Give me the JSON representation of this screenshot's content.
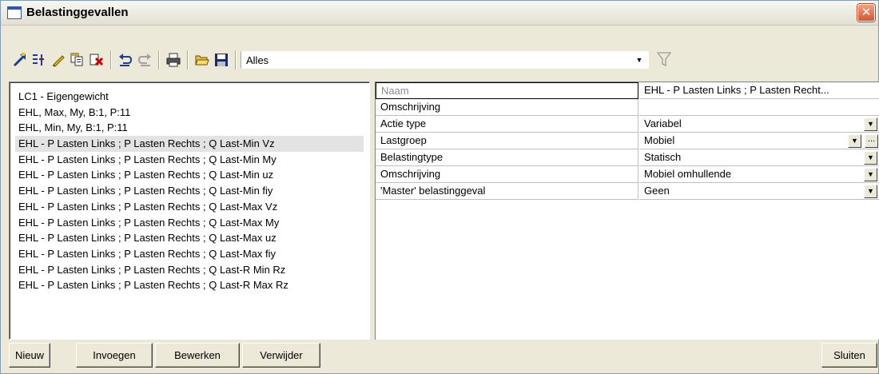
{
  "window": {
    "title": "Belastinggevallen",
    "close_label": "✕"
  },
  "toolbar": {
    "icons": [
      "new-load-case-icon",
      "insert-icon",
      "edit-icon",
      "copy-icon",
      "delete-icon",
      "undo-icon",
      "redo-icon",
      "print-icon",
      "open-folder-icon",
      "save-icon"
    ],
    "filter_value": "Alles",
    "filter_icon": "funnel-filter-icon"
  },
  "load_cases": [
    "LC1 - Eigengewicht",
    "EHL, Max, My, B:1, P:11",
    "EHL, Min, My, B:1, P:11",
    "EHL - P Lasten Links ; P Lasten Rechts ; Q Last-Min Vz",
    "EHL - P Lasten Links ; P Lasten Rechts ; Q Last-Min My",
    "EHL - P Lasten Links ; P Lasten Rechts ; Q Last-Min uz",
    "EHL - P Lasten Links ; P Lasten Rechts ; Q Last-Min fiy",
    "EHL - P Lasten Links ; P Lasten Rechts ; Q Last-Max Vz",
    "EHL - P Lasten Links ; P Lasten Rechts ; Q Last-Max My",
    "EHL - P Lasten Links ; P Lasten Rechts ; Q Last-Max uz",
    "EHL - P Lasten Links ; P Lasten Rechts ; Q Last-Max fiy",
    "EHL - P Lasten Links ; P Lasten Rechts ; Q Last-R Min Rz",
    "EHL - P Lasten Links ; P Lasten Rechts ; Q Last-R Max Rz"
  ],
  "selected_index": 3,
  "properties": [
    {
      "name": "Naam",
      "value": "EHL - P Lasten Links ; P Lasten Recht...",
      "dropdown": false,
      "ellipsis": false
    },
    {
      "name": "Omschrijving",
      "value": "",
      "dropdown": false,
      "ellipsis": false
    },
    {
      "name": "Actie type",
      "value": "Variabel",
      "dropdown": true,
      "ellipsis": false
    },
    {
      "name": "Lastgroep",
      "value": "Mobiel",
      "dropdown": true,
      "ellipsis": true
    },
    {
      "name": "Belastingtype",
      "value": "Statisch",
      "dropdown": true,
      "ellipsis": false
    },
    {
      "name": "Omschrijving",
      "value": "Mobiel omhullende",
      "dropdown": true,
      "ellipsis": false
    },
    {
      "name": "'Master' belastinggeval",
      "value": "Geen",
      "dropdown": true,
      "ellipsis": false
    }
  ],
  "buttons": {
    "new": "Nieuw",
    "insert": "Invoegen",
    "edit": "Bewerken",
    "delete": "Verwijder",
    "close": "Sluiten"
  },
  "colors": {
    "window_bg": "#ece9d8",
    "selected_row": "#e3e3e3",
    "close_button": "#d8552c"
  }
}
